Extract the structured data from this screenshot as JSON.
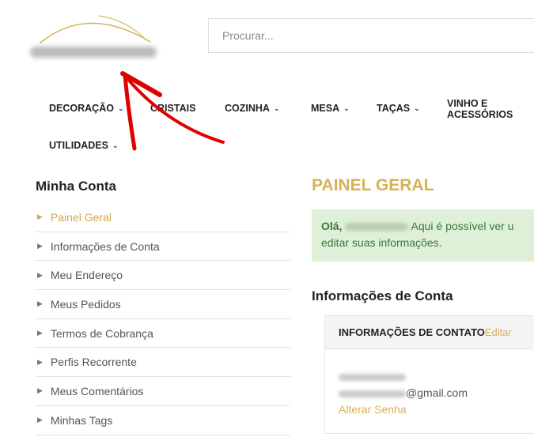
{
  "header": {
    "search_placeholder": "Procurar..."
  },
  "nav": [
    {
      "label": "DECORAÇÃO",
      "dropdown": true
    },
    {
      "label": "CRISTAIS",
      "dropdown": false
    },
    {
      "label": "COZINHA",
      "dropdown": true
    },
    {
      "label": "MESA",
      "dropdown": true
    },
    {
      "label": "TAÇAS",
      "dropdown": true
    },
    {
      "label": "VINHO E ACESSÓRIOS",
      "dropdown": false
    },
    {
      "label": "UTILIDADES",
      "dropdown": true
    }
  ],
  "sidebar": {
    "title": "Minha Conta",
    "items": [
      {
        "label": "Painel Geral",
        "active": true
      },
      {
        "label": "Informações de Conta"
      },
      {
        "label": "Meu Endereço"
      },
      {
        "label": "Meus Pedidos"
      },
      {
        "label": "Termos de Cobrança"
      },
      {
        "label": "Perfis Recorrente"
      },
      {
        "label": "Meus Comentários"
      },
      {
        "label": "Minhas Tags"
      }
    ]
  },
  "main": {
    "title": "PAINEL GERAL",
    "greeting": "Olá,",
    "alert_text": "Aqui é possível ver u",
    "alert_text2": "editar suas informações.",
    "section_title": "Informações de Conta",
    "contact_header": "INFORMAÇÕES DE CONTATO",
    "edit_label": "Editar",
    "email_suffix": "@gmail.com",
    "change_password": "Alterar Senha"
  },
  "colors": {
    "accent": "#d4b25a",
    "alert_bg": "#dff0d8",
    "alert_text": "#3c763d",
    "annotation_arrow": "#e00000"
  }
}
